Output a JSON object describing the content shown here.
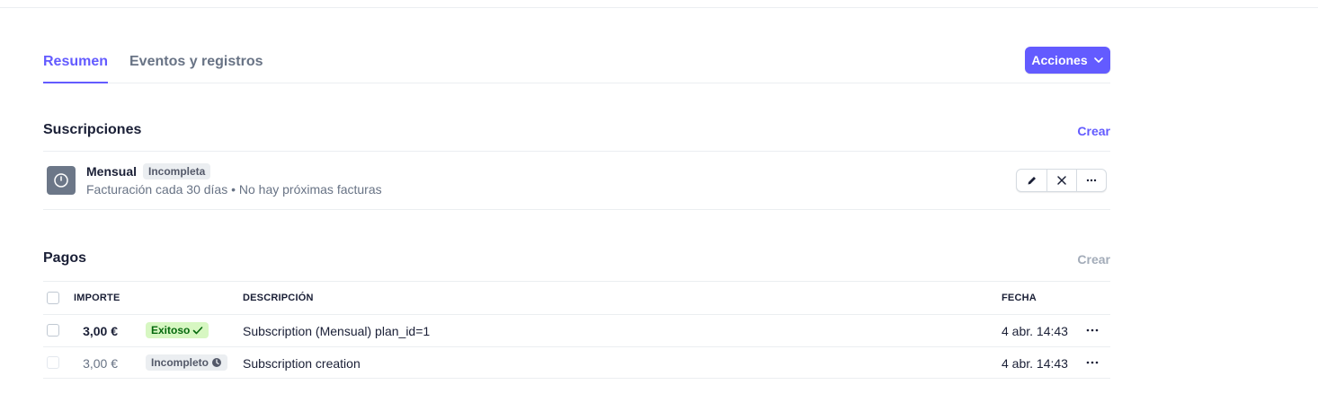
{
  "tabs": [
    {
      "label": "Resumen",
      "active": true
    },
    {
      "label": "Eventos y registros",
      "active": false
    }
  ],
  "actions_label": "Acciones",
  "subscriptions": {
    "title": "Suscripciones",
    "create_label": "Crear",
    "item": {
      "name": "Mensual",
      "status": "Incompleta",
      "detail": "Facturación cada 30 días • No hay próximas facturas",
      "icon": "clock-icon"
    }
  },
  "payments": {
    "title": "Pagos",
    "create_label": "Crear",
    "columns": {
      "amount": "IMPORTE",
      "description": "DESCRIPCIÓN",
      "date": "FECHA"
    },
    "rows": [
      {
        "amount": "3,00 €",
        "status": "Exitoso",
        "status_icon": "check-icon",
        "description": "Subscription (Mensual) plan_id=1",
        "date": "4 abr. 14:43"
      },
      {
        "amount": "3,00 €",
        "status": "Incompleto",
        "status_icon": "clock-icon",
        "description": "Subscription creation",
        "date": "4 abr. 14:43"
      }
    ]
  },
  "colors": {
    "accent": "#635bff",
    "success_bg": "#d7f7c2",
    "success_text": "#05690d",
    "neutral_bg": "#ebeef1"
  }
}
